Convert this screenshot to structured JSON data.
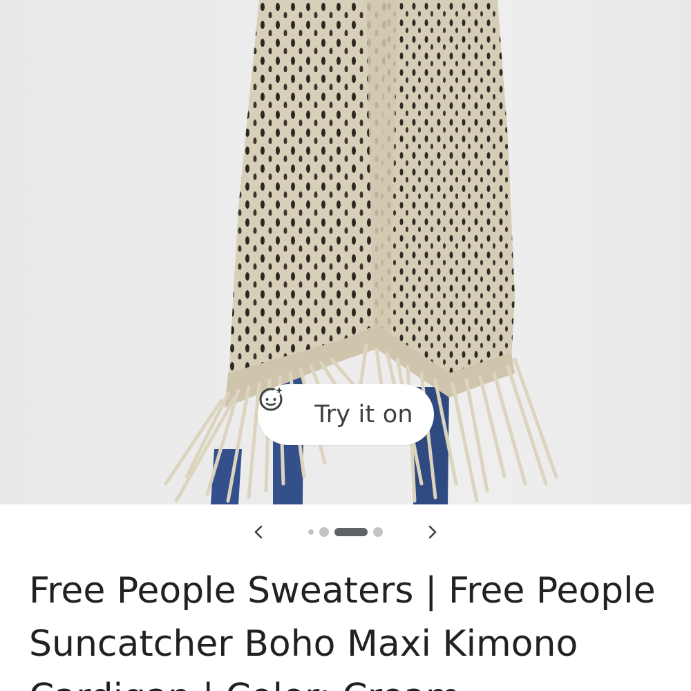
{
  "product": {
    "try_on_label": "Try it on",
    "title": "Free People Sweaters | Free People Suncatcher Boho Maxi Kimono Cardigan | Color: Cream"
  },
  "carousel": {
    "total_images": 4,
    "current_index": 3
  },
  "icons": {
    "try_on": "face-sparkle-icon",
    "prev": "chevron-left-icon",
    "next": "chevron-right-icon"
  },
  "colors": {
    "knit": "#d8cfb9",
    "background": "#ececec",
    "text": "#202124",
    "active_dot": "#5f6368",
    "inactive_dot": "#c4c4c4"
  }
}
